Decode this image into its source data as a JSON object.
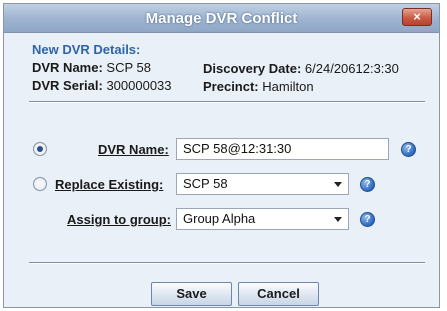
{
  "window": {
    "title": "Manage DVR Conflict",
    "close_label": "×"
  },
  "details": {
    "heading": "New DVR Details:",
    "dvr_name_label": "DVR Name:",
    "dvr_name_value": "SCP 58",
    "dvr_serial_label": "DVR Serial:",
    "dvr_serial_value": "300000033",
    "discovery_date_label": "Discovery Date:",
    "discovery_date_value": "6/24/20612:3:30",
    "precinct_label": "Precinct:",
    "precinct_value": "Hamilton"
  },
  "form": {
    "dvr_name_option": {
      "label": "DVR Name:",
      "value": "SCP 58@12:31:30",
      "selected": true
    },
    "replace_existing_option": {
      "label": "Replace Existing:",
      "value": "SCP 58",
      "selected": false
    },
    "assign_group": {
      "label": "Assign to group:",
      "value": "Group Alpha"
    },
    "help_icon_glyph": "?"
  },
  "buttons": {
    "save_label": "Save",
    "cancel_label": "Cancel"
  },
  "colors": {
    "title_bar": "#9db3cf",
    "accent_heading": "#2f64a8",
    "close_button": "#c95a44"
  }
}
